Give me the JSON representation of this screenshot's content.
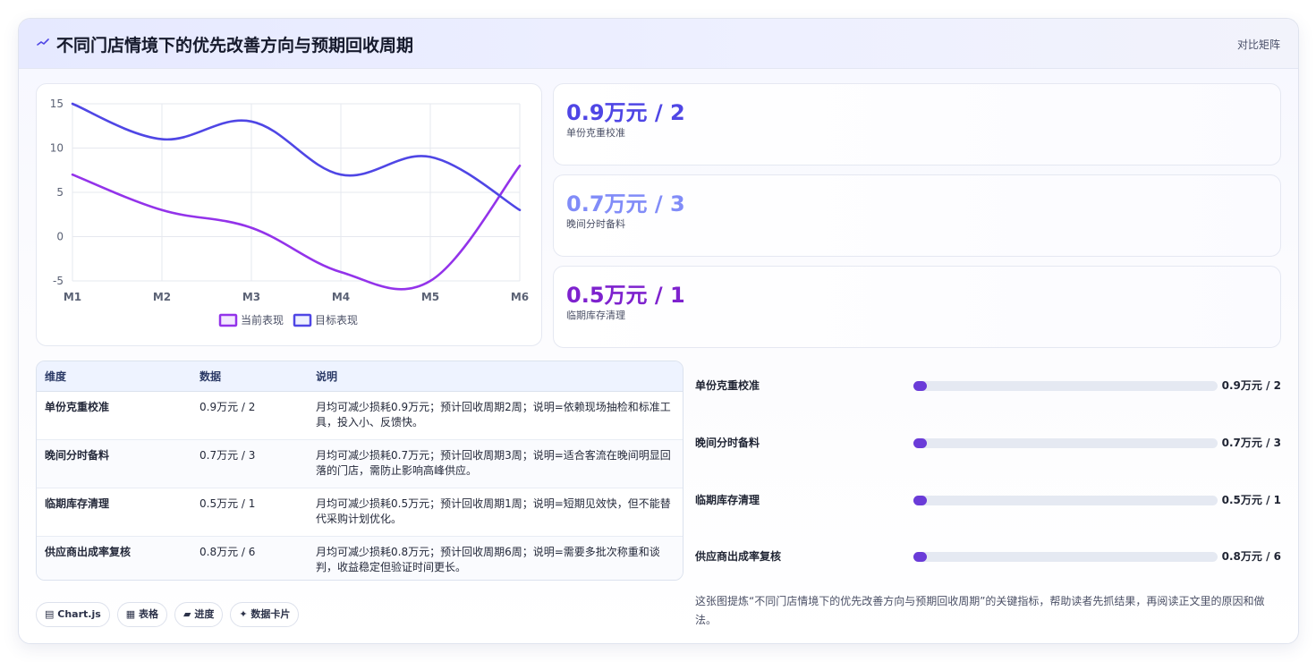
{
  "header": {
    "title": "不同门店情境下的优先改善方向与预期回收周期",
    "action": "对比矩阵"
  },
  "chart_data": {
    "type": "line",
    "categories": [
      "M1",
      "M2",
      "M3",
      "M4",
      "M5",
      "M6"
    ],
    "series": [
      {
        "name": "当前表现",
        "values": [
          7,
          3,
          1,
          -4,
          -5,
          8
        ],
        "color": "#9333ea"
      },
      {
        "name": "目标表现",
        "values": [
          15,
          11,
          13,
          7,
          9,
          3
        ],
        "color": "#4f46e5"
      }
    ],
    "ylim": [
      -5,
      15
    ],
    "yticks": [
      15,
      10,
      5,
      0,
      -5
    ],
    "grid": true,
    "legend": "bottom",
    "title": "",
    "xlabel": "",
    "ylabel": ""
  },
  "kpis": [
    {
      "value": "0.9万元 / 2",
      "label": "单份克重校准",
      "color": "#4f46e5"
    },
    {
      "value": "0.7万元 / 3",
      "label": "晚间分时备料",
      "color": "#818cf8"
    },
    {
      "value": "0.5万元 / 1",
      "label": "临期库存清理",
      "color": "#7e22ce"
    }
  ],
  "table": {
    "headers": [
      "维度",
      "数据",
      "说明"
    ],
    "rows": [
      [
        "单份克重校准",
        "0.9万元 / 2",
        "月均可减少损耗0.9万元；预计回收周期2周；说明=依赖现场抽检和标准工具，投入小、反馈快。"
      ],
      [
        "晚间分时备料",
        "0.7万元 / 3",
        "月均可减少损耗0.7万元；预计回收周期3周；说明=适合客流在晚间明显回落的门店，需防止影响高峰供应。"
      ],
      [
        "临期库存清理",
        "0.5万元 / 1",
        "月均可减少损耗0.5万元；预计回收周期1周；说明=短期见效快，但不能替代采购计划优化。"
      ],
      [
        "供应商出成率复核",
        "0.8万元 / 6",
        "月均可减少损耗0.8万元；预计回收周期6周；说明=需要多批次称重和谈判，收益稳定但验证时间更长。"
      ]
    ]
  },
  "progress": [
    {
      "label": "单份克重校准",
      "value": "0.9万元 / 2",
      "fraction": 0.045
    },
    {
      "label": "晚间分时备料",
      "value": "0.7万元 / 3",
      "fraction": 0.045
    },
    {
      "label": "临期库存清理",
      "value": "0.5万元 / 1",
      "fraction": 0.045
    },
    {
      "label": "供应商出成率复核",
      "value": "0.8万元 / 6",
      "fraction": 0.045
    }
  ],
  "tags": [
    {
      "icon": "▤",
      "label": "Chart.js"
    },
    {
      "icon": "▦",
      "label": "表格"
    },
    {
      "icon": "▰",
      "label": "进度"
    },
    {
      "icon": "✦",
      "label": "数据卡片"
    }
  ],
  "summary": "这张图提炼“不同门店情境下的优先改善方向与预期回收周期”的关键指标，帮助读者先抓结果，再阅读正文里的原因和做法。"
}
